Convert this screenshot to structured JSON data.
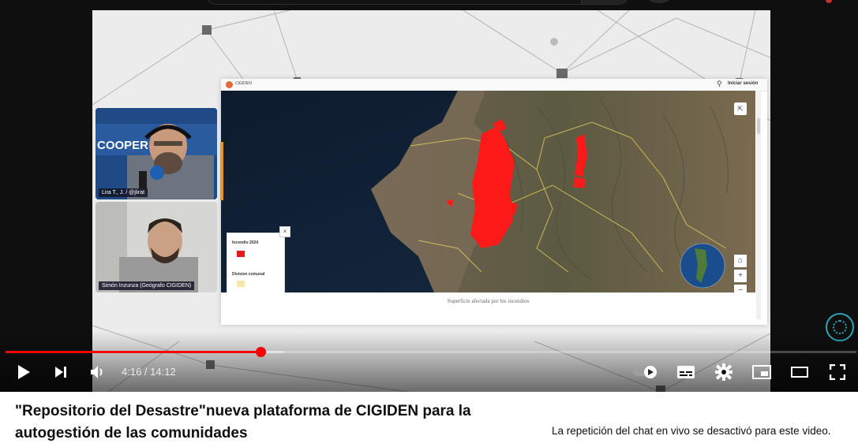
{
  "video_overlay": {
    "web_brand": "CIGIDEN",
    "web_login": "Iniciar sesión",
    "legend_fire": "Incendio 2024",
    "legend_division": "Division comunal",
    "legend_close": "×",
    "map_caption": "Superficie afectada por los incendios",
    "cam1_name": "Lira T., J. / @jlirat",
    "cam2_name": "Simón Inzunza (Geógrafo CIGIDEN)",
    "studio_sign": "COOPER"
  },
  "player": {
    "current_time": "4:16",
    "duration": "14:12",
    "time_display": "4:16 / 14:12",
    "progress_fraction": 0.2998,
    "buffer_fraction": 0.3262,
    "progress_color": "#ff0000",
    "icons": [
      "play-icon",
      "next-icon",
      "volume-icon",
      "autoplay-toggle-icon",
      "subtitles-icon",
      "settings-gear-icon",
      "miniplayer-icon",
      "theater-mode-icon",
      "fullscreen-icon"
    ]
  },
  "video": {
    "title": "\"Repositorio del Desastre\"nueva plataforma de CIGIDEN para la autogestión de las comunidades"
  },
  "chat": {
    "replay_disabled": "La repetición del chat en vivo se desactivó para este video."
  }
}
